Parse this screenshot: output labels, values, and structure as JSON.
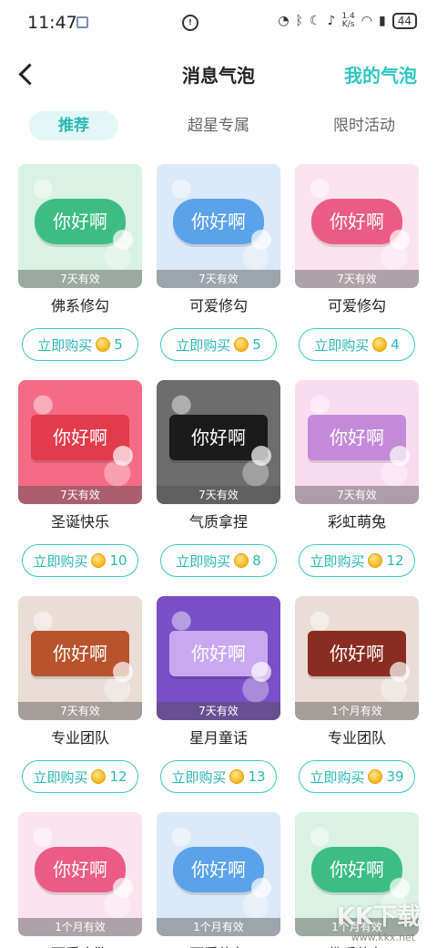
{
  "status_bar": {
    "time": "11:47",
    "speed_top": "1.4",
    "speed_bottom": "K/s",
    "battery": "44"
  },
  "header": {
    "title": "消息气泡",
    "my_bubble_label": "我的气泡"
  },
  "tabs": [
    {
      "label": "推荐",
      "active": true
    },
    {
      "label": "超星专属",
      "active": false
    },
    {
      "label": "限时活动",
      "active": false
    }
  ],
  "buy_label": "立即购买",
  "bubble_text": "你好啊",
  "cards": [
    {
      "name": "佛系修勾",
      "validity": "7天有效",
      "price": "5",
      "bg": "#d9f2e3",
      "bubble": "#3dbd84",
      "shape": "round"
    },
    {
      "name": "可爱修勾",
      "validity": "7天有效",
      "price": "5",
      "bg": "#dbe9f8",
      "bubble": "#5aa2ea",
      "shape": "round"
    },
    {
      "name": "可爱修勾",
      "validity": "7天有效",
      "price": "4",
      "bg": "#fbe4ee",
      "bubble": "#ec5b86",
      "shape": "round"
    },
    {
      "name": "圣诞快乐",
      "validity": "7天有效",
      "price": "10",
      "bg": "#f56b86",
      "bubble": "#e23b4c",
      "shape": "rect"
    },
    {
      "name": "气质拿捏",
      "validity": "7天有效",
      "price": "8",
      "bg": "#6d6d6d",
      "bubble": "#1b1b1b",
      "shape": "rect"
    },
    {
      "name": "彩虹萌兔",
      "validity": "7天有效",
      "price": "12",
      "bg": "#fadcf0",
      "bubble": "#c38ad9",
      "shape": "rect"
    },
    {
      "name": "专业团队",
      "validity": "7天有效",
      "price": "12",
      "bg": "#e9ddd5",
      "bubble": "#b8532d",
      "shape": "rect"
    },
    {
      "name": "星月童话",
      "validity": "7天有效",
      "price": "13",
      "bg": "#7a4fc7",
      "bubble": "#c9a8f0",
      "shape": "rect"
    },
    {
      "name": "专业团队",
      "validity": "1个月有效",
      "price": "39",
      "bg": "#e9ddd5",
      "bubble": "#8a2c21",
      "shape": "rect"
    },
    {
      "name": "可爱小狗",
      "validity": "1个月有效",
      "price": "",
      "bg": "#fbe4ee",
      "bubble": "#ec5b86",
      "shape": "round"
    },
    {
      "name": "可爱修勾",
      "validity": "1个月有效",
      "price": "",
      "bg": "#dbe9f8",
      "bubble": "#5aa2ea",
      "shape": "round"
    },
    {
      "name": "佛系修勾",
      "validity": "1个月有效",
      "price": "",
      "bg": "#d9f2e3",
      "bubble": "#3dbd84",
      "shape": "round"
    }
  ],
  "watermark": "KK下载",
  "watermark_url": "www.kkx.net",
  "colors": {
    "accent": "#2ec7c2",
    "tab_active_bg": "#e2f7f6"
  }
}
